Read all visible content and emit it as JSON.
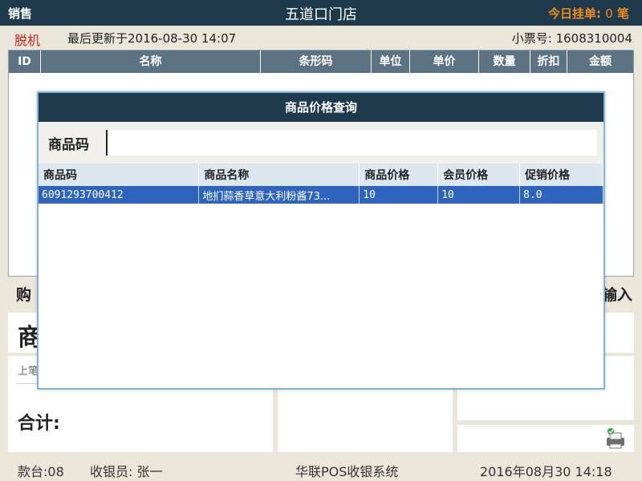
{
  "titlebar": {
    "mode": "销售",
    "store_name": "五道口门店",
    "hold_label": "今日挂单:",
    "hold_count": "0",
    "hold_unit": "笔"
  },
  "status": {
    "offline": "脱机",
    "last_update": "最后更新于2016-08-30 14:07",
    "receipt_label": "小票号:",
    "receipt_no": "1608310004"
  },
  "grid": {
    "columns": [
      "ID",
      "名称",
      "条形码",
      "单位",
      "单价",
      "数量",
      "折扣",
      "金额"
    ]
  },
  "lower": {
    "cart_label_partial": "购",
    "input_label_partial": "输入",
    "product_label_partial": "商",
    "prev_label_partial": "上笔",
    "total_label": "合计:"
  },
  "footer": {
    "terminal": "款台:08",
    "cashier": "收银员: 张一",
    "system": "华联POS收银系统",
    "datetime": "2016年08月30  14:18"
  },
  "modal": {
    "title": "商品价格查询",
    "search_label": "商品码",
    "search_value": "",
    "columns": [
      "商品码",
      "商品名称",
      "商品价格",
      "会员价格",
      "促销价格"
    ],
    "rows": [
      {
        "code": "6091293700412",
        "name": "地扪蒜香草意大利粉酱73...",
        "price": "10",
        "member_price": "10",
        "promo_price": "8.0"
      }
    ]
  },
  "colors": {
    "header_bg": "#1e3a4c",
    "offline": "#d0211d",
    "hold": "#f28a18",
    "selected_row": "#2e64bd"
  }
}
